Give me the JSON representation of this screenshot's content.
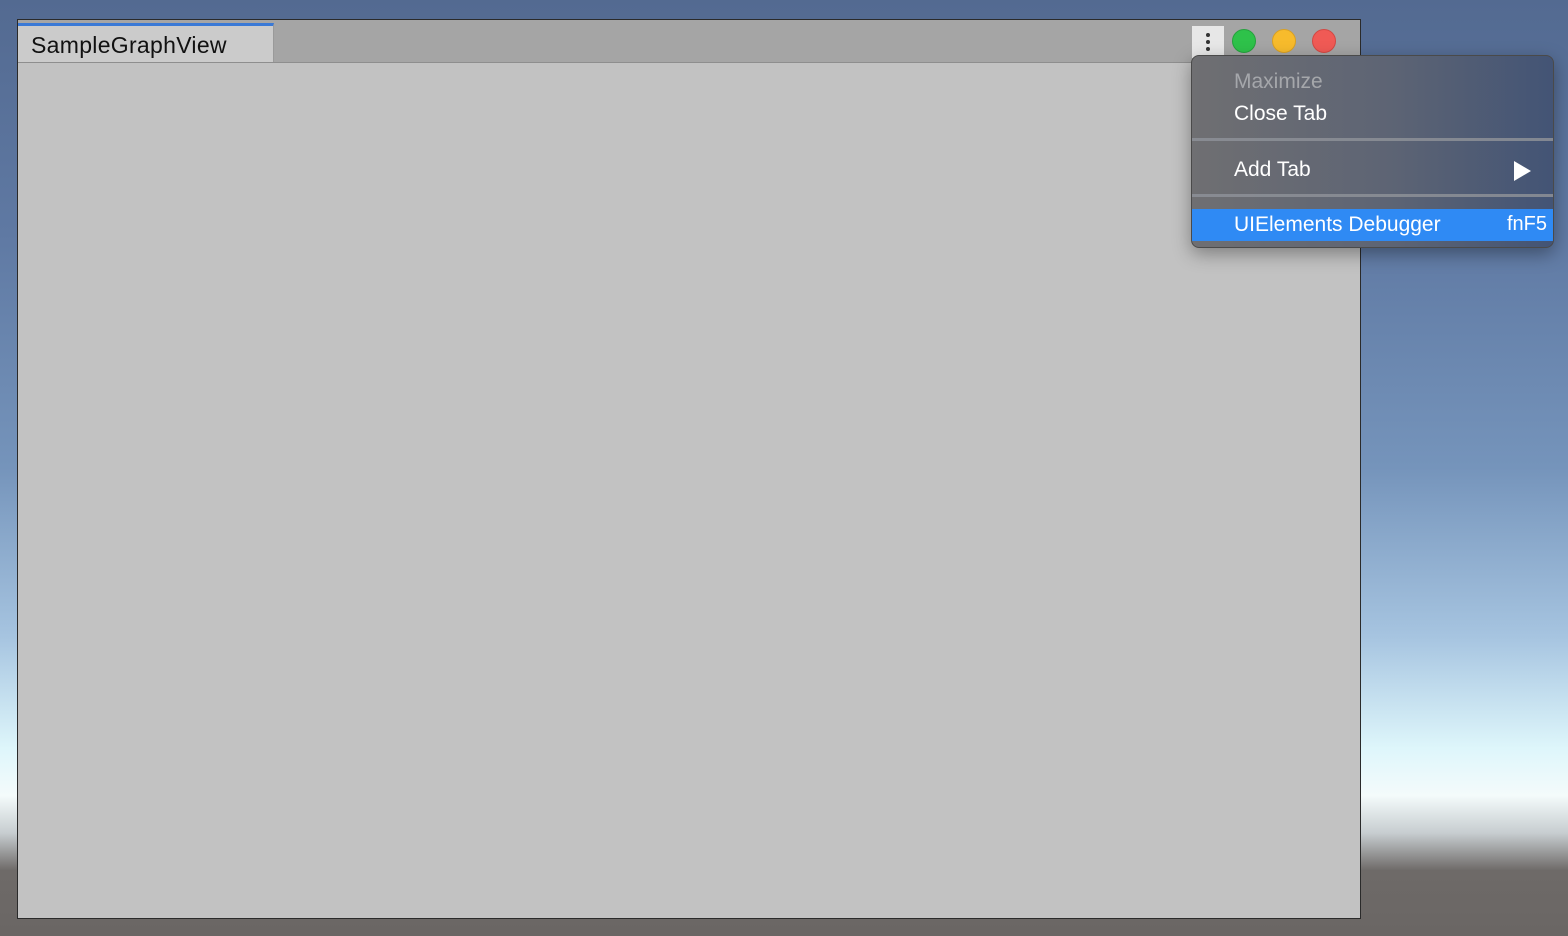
{
  "window": {
    "tab_title": "SampleGraphView",
    "controls": {
      "kebab_icon": "vertical-ellipsis-icon",
      "green": "#2ec24a",
      "yellow": "#f7bb2c",
      "red": "#f05a55"
    }
  },
  "menu": {
    "items": [
      {
        "label": "Maximize",
        "enabled": false
      },
      {
        "label": "Close Tab",
        "enabled": true
      },
      {
        "label": "Add Tab",
        "enabled": true,
        "submenu": true
      },
      {
        "label": "UIElements Debugger",
        "shortcut": "fnF5",
        "highlighted": true
      }
    ],
    "highlight_color": "#2f8af4"
  }
}
